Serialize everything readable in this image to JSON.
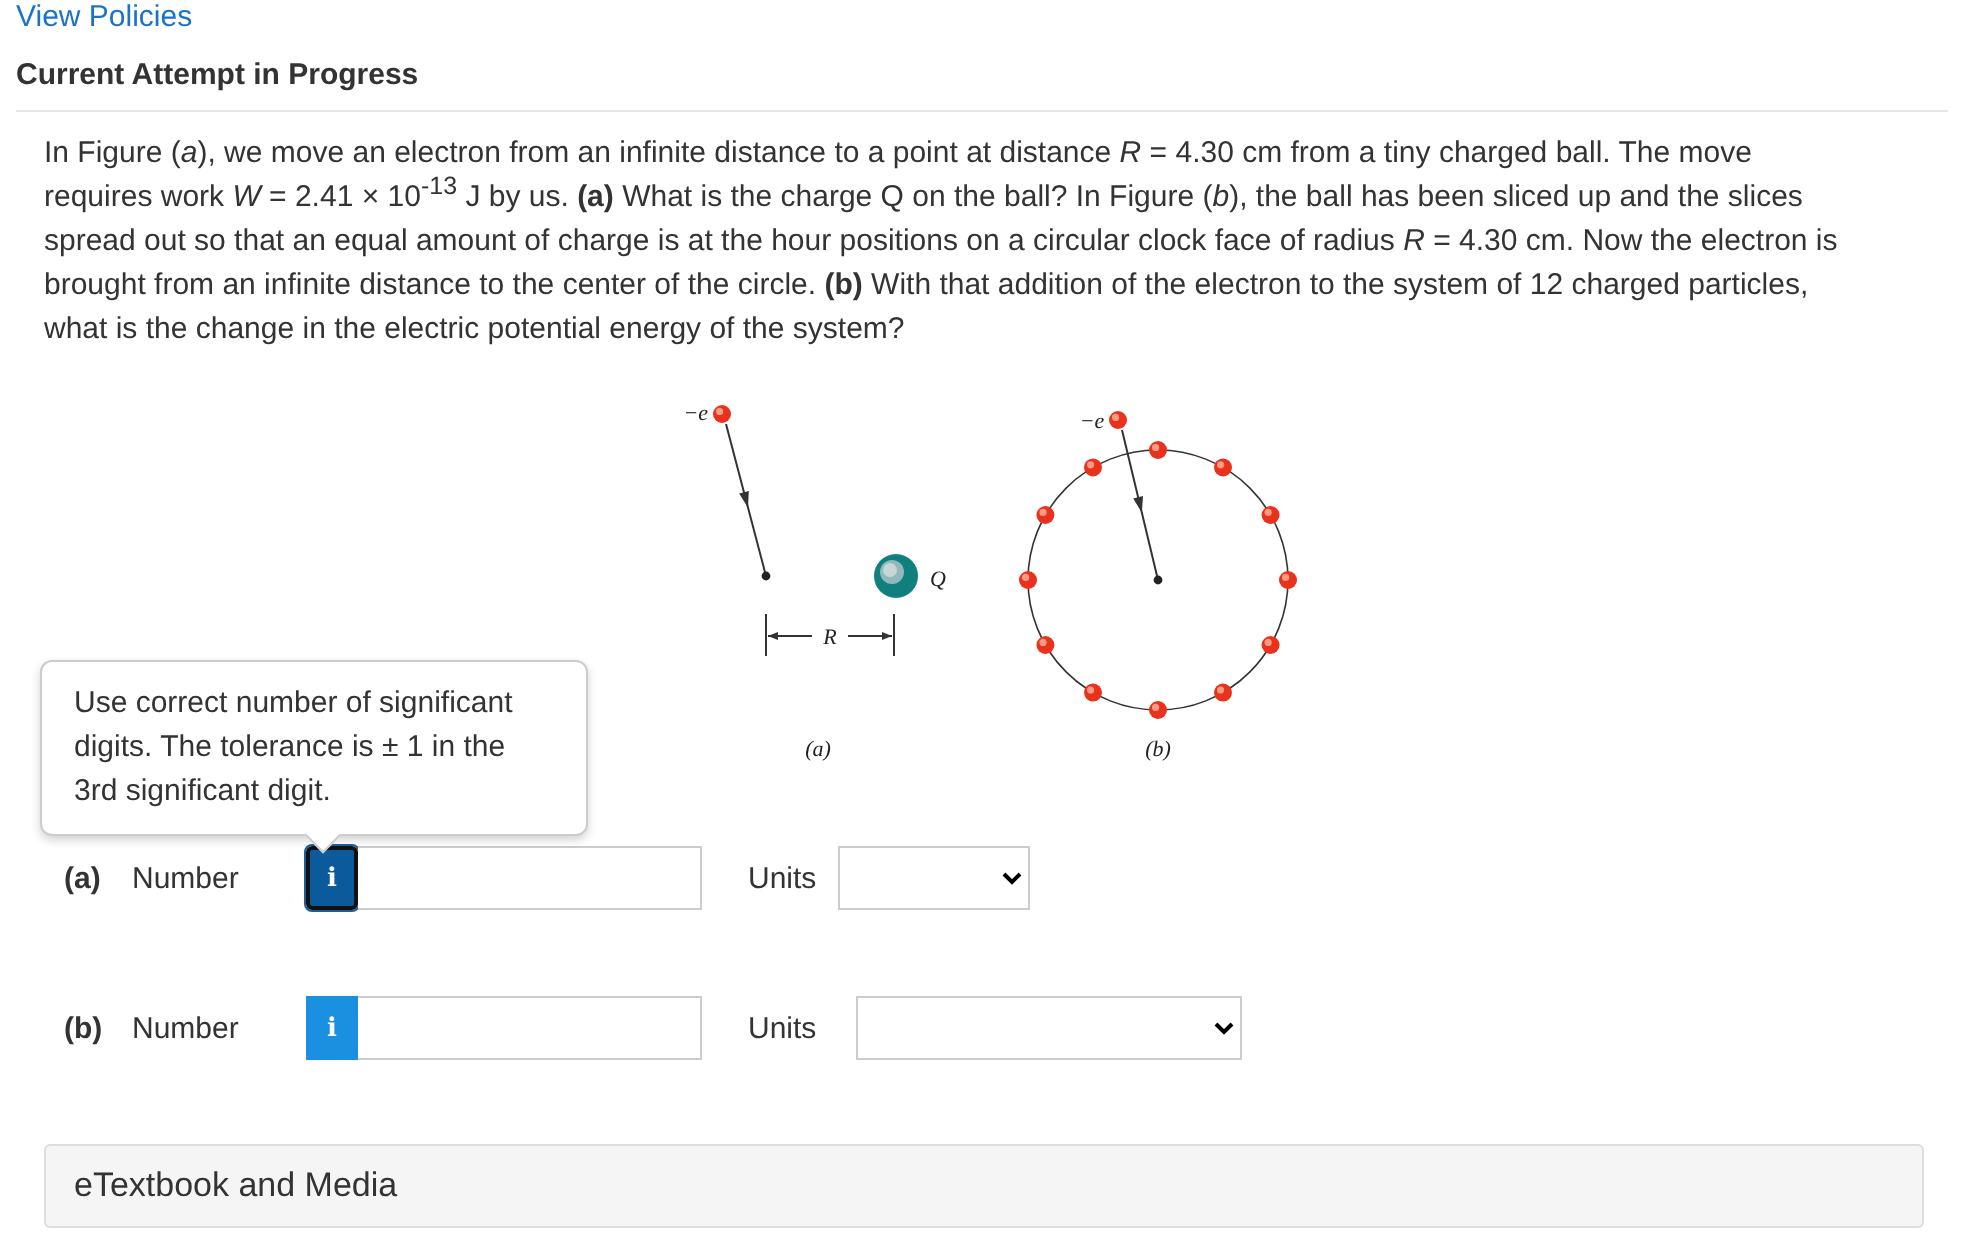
{
  "header_link": "View Policies",
  "attempt_title": "Current Attempt in Progress",
  "question": "In Figure (*a*), we move an electron from an infinite distance to a point at distance *R* = 4.30 cm from a tiny charged ball. The move requires work *W* = 2.41 × 10$^{-13}$ J by us. **(a)** What is the charge Q on the ball? In Figure (*b*), the ball has been sliced up and the slices spread out so that an equal amount of charge is at the hour positions on a circular clock face of radius *R* = 4.30 cm. Now the electron is brought from an infinite distance to the center of the circle. **(b)** With that addition of the electron to the system of 12 charged particles, what is the change in the electric potential energy of the system?",
  "figure": {
    "panels": [
      {
        "kind": "single",
        "caption": "(a)",
        "electron_label": "−e",
        "charge_label": "Q",
        "distance_label": "R"
      },
      {
        "kind": "clock",
        "caption": "(b)",
        "electron_label": "−e"
      }
    ]
  },
  "tooltip": {
    "text": "Use correct number of significant digits. The tolerance is ± 1 in the 3rd significant digit."
  },
  "answers": [
    {
      "part": "(a)",
      "label": "Number",
      "info": "i",
      "focused": true,
      "units_label": "Units"
    },
    {
      "part": "(b)",
      "label": "Number",
      "info": "i",
      "focused": false,
      "units_label": "Units"
    }
  ],
  "resources": "eTextbook and Media"
}
